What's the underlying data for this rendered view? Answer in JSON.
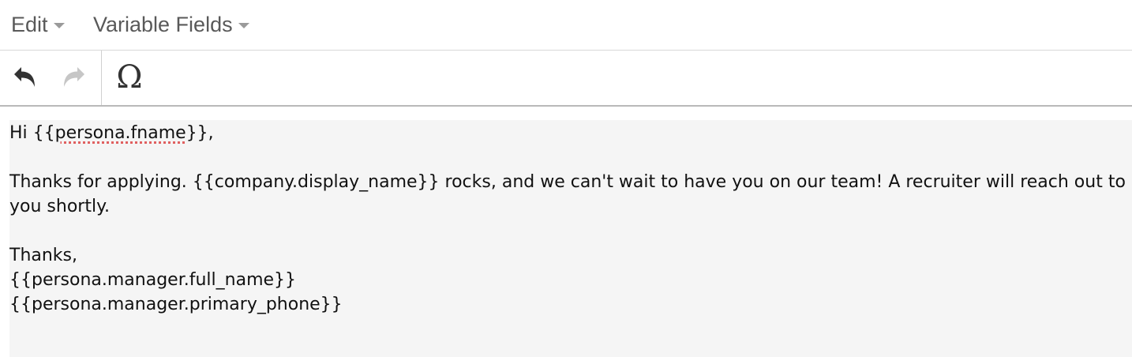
{
  "menubar": {
    "edit_label": "Edit",
    "variable_fields_label": "Variable Fields"
  },
  "toolbar": {
    "undo_icon": "undo-arrow-icon",
    "redo_icon": "redo-arrow-icon",
    "special_char_glyph": "Ω"
  },
  "content": {
    "greeting_prefix": "Hi {{",
    "greeting_token": "persona.fname",
    "greeting_suffix": "}},",
    "body_line": "Thanks for applying. {{company.display_name}} rocks, and we can't wait to have you on our team! A recruiter will reach out to you shortly.",
    "signoff": "Thanks,",
    "signature_name": "{{persona.manager.full_name}}",
    "signature_phone": "{{persona.manager.primary_phone}}"
  },
  "colors": {
    "menu_text": "#595959",
    "content_bg": "#f5f5f5",
    "spellcheck_underline": "#e06060"
  }
}
